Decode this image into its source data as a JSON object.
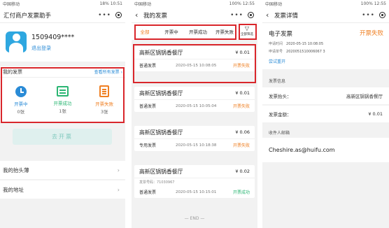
{
  "phone1": {
    "status": {
      "left": "中国移动",
      "right": "18% 10:51"
    },
    "nav": {
      "title": "汇付商户发票助手"
    },
    "user": {
      "id": "1509409****",
      "logout": "退出登录"
    },
    "invoices": {
      "title": "我的发票",
      "view_all": "查看所有发票",
      "stats": [
        {
          "label": "开票中",
          "count": "0张",
          "icon": "clock-icon"
        },
        {
          "label": "开票成功",
          "count": "1张",
          "icon": "invoice-ok-icon"
        },
        {
          "label": "开票失败",
          "count": "3张",
          "icon": "invoice-fail-icon"
        }
      ]
    },
    "open_button": "去开票",
    "menu": [
      {
        "label": "我的抬头薄"
      },
      {
        "label": "我的地址"
      }
    ]
  },
  "phone2": {
    "status": {
      "left": "中国移动",
      "right": "100% 12:55"
    },
    "nav": {
      "title": "我的发票"
    },
    "tabs": [
      "全部",
      "开票中",
      "开票成功",
      "开票失败"
    ],
    "filter_label": "全部筛选",
    "cards": [
      {
        "title": "高新区锅锅香餐厅",
        "amount": "¥ 0.01",
        "type": "普通发票",
        "time": "2020-05-15 10:08:05",
        "status": "开票失败"
      },
      {
        "title": "高新区锅锅香餐厅",
        "amount": "¥ 0.01",
        "type": "普通发票",
        "time": "2020-05-15 10:05:04",
        "status": "开票失败"
      },
      {
        "title": "高新区锅锅香餐厅",
        "amount": "¥ 0.06",
        "type": "专用发票",
        "time": "2020-05-15 10:18:38",
        "status": "开票失败"
      },
      {
        "title": "高新区锅锅香餐厅",
        "amount": "¥ 0.02",
        "number": "发票号码：71030967",
        "type": "普通发票",
        "time": "2020-05-15 10:15:01",
        "status": "开票成功"
      }
    ],
    "end_text": "— END —"
  },
  "phone3": {
    "status": {
      "left": "中国移动",
      "right": "100% 12:55"
    },
    "nav": {
      "title": "发票详情"
    },
    "detail": {
      "title": "电子发票",
      "status": "开票失败",
      "apply_time_label": "申请时间",
      "apply_time": "2020-05-15 10:08:05",
      "apply_no_label": "申请单号",
      "apply_no": "2020051510006067 3",
      "retry": "尝试重开"
    },
    "info_label": "发票信息",
    "header_label": "发票抬头：",
    "header_value": "高新区锅锅香餐厅",
    "amount_label": "发票金额：",
    "amount_value": "¥ 0.01",
    "mail_label": "收件人邮箱",
    "mail_value": "Cheshire.as@huifu.com"
  },
  "colors": {
    "accent_orange": "#ef7f22",
    "success_green": "#2bb673",
    "link_blue": "#2a8bd6",
    "highlight_red": "#d9262b"
  }
}
